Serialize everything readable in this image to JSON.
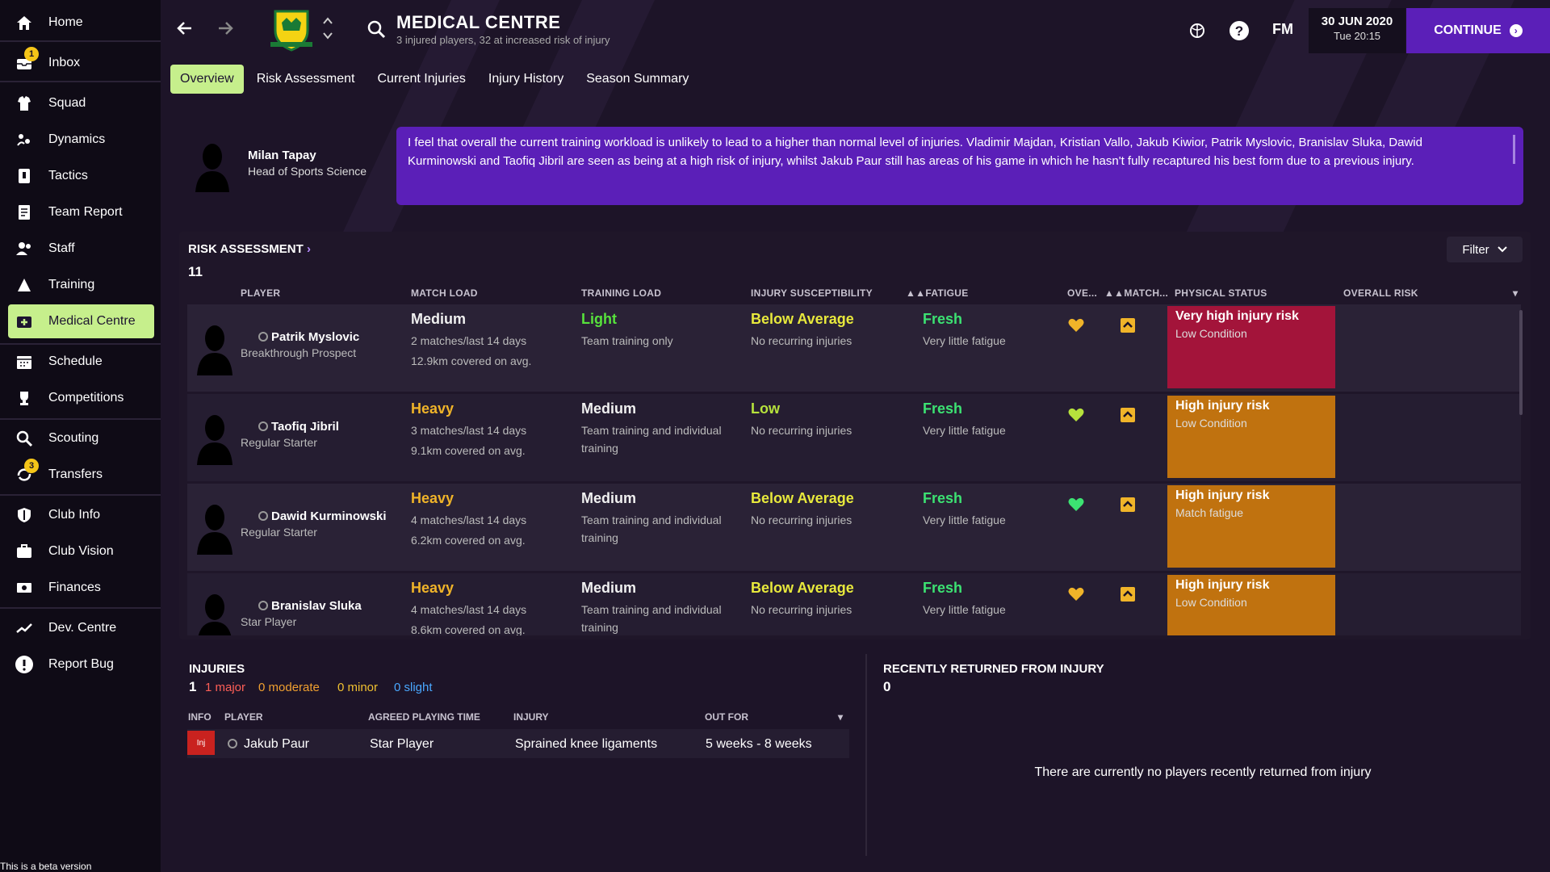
{
  "sidebar": {
    "items": [
      {
        "label": "Home",
        "icon": "home-icon"
      },
      {
        "label": "Inbox",
        "icon": "inbox-icon",
        "badge": "1"
      },
      {
        "label": "Squad",
        "icon": "squad-icon"
      },
      {
        "label": "Dynamics",
        "icon": "dynamics-icon"
      },
      {
        "label": "Tactics",
        "icon": "tactics-icon"
      },
      {
        "label": "Team Report",
        "icon": "report-icon"
      },
      {
        "label": "Staff",
        "icon": "staff-icon"
      },
      {
        "label": "Training",
        "icon": "training-icon"
      },
      {
        "label": "Medical Centre",
        "icon": "medical-icon"
      },
      {
        "label": "Schedule",
        "icon": "calendar-icon"
      },
      {
        "label": "Competitions",
        "icon": "trophy-icon"
      },
      {
        "label": "Scouting",
        "icon": "search-icon"
      },
      {
        "label": "Transfers",
        "icon": "transfers-icon",
        "badge": "3"
      },
      {
        "label": "Club Info",
        "icon": "shield-icon"
      },
      {
        "label": "Club Vision",
        "icon": "briefcase-icon"
      },
      {
        "label": "Finances",
        "icon": "money-icon"
      },
      {
        "label": "Dev. Centre",
        "icon": "chart-icon"
      },
      {
        "label": "Report Bug",
        "icon": "alert-icon"
      }
    ],
    "active": "Medical Centre",
    "beta": "This is a beta version"
  },
  "header": {
    "title": "MEDICAL CENTRE",
    "subtitle": "3 injured players, 32 at increased risk of injury",
    "logo": "FM",
    "date": "30 JUN 2020",
    "time": "Tue 20:15",
    "continue": "CONTINUE"
  },
  "tabs": [
    "Overview",
    "Risk Assessment",
    "Current Injuries",
    "Injury History",
    "Season Summary"
  ],
  "staff": {
    "name": "Milan Tapay",
    "role": "Head of Sports Science",
    "advice": "I feel that overall the current training workload is unlikely to lead to a higher than normal level of injuries. Vladimir Majdan, Kristian Vallo, Jakub Kiwior, Patrik Myslovic, Branislav Sluka, Dawid Kurminowski and Taofiq Jibril are seen as being at a high risk of injury, whilst Jakub Paur still has areas of his game in which he hasn't fully recaptured his best form due to a previous injury."
  },
  "risk": {
    "title": "RISK ASSESSMENT",
    "count": "11",
    "filter": "Filter",
    "columns": {
      "player": "PLAYER",
      "match_load": "MATCH LOAD",
      "training_load": "TRAINING LOAD",
      "injury_susceptibility": "INJURY SUSCEPTIBILITY",
      "fatigue": "FATIGUE",
      "overall": "OVE...",
      "match": "MATCH...",
      "physical_status": "PHYSICAL STATUS",
      "overall_risk": "OVERALL RISK"
    },
    "rows": [
      {
        "name": "Patrik Myslovic",
        "role": "Breakthrough Prospect",
        "match_load": "Medium",
        "match_sub1": "2 matches/last 14 days",
        "match_sub2": "12.9km covered on avg.",
        "training_load": "Light",
        "training_sub": "Team training only",
        "susceptibility": "Below Average",
        "susc_sub": "No recurring injuries",
        "fatigue": "Fresh",
        "fatigue_sub": "Very little fatigue",
        "heart_color": "#f0b429",
        "risk": "Very high injury risk",
        "risk_sub": "Low Condition",
        "risk_color": "#a3143a",
        "match_color": "#f0f0f0",
        "training_color": "#57e23c",
        "susc_color": "#e8e93c"
      },
      {
        "name": "Taofiq Jibril",
        "role": "Regular Starter",
        "match_load": "Heavy",
        "match_sub1": "3 matches/last 14 days",
        "match_sub2": "9.1km covered on avg.",
        "training_load": "Medium",
        "training_sub": "Team training and individual training",
        "susceptibility": "Low",
        "susc_sub": "No recurring injuries",
        "fatigue": "Fresh",
        "fatigue_sub": "Very little fatigue",
        "heart_color": "#b6e23c",
        "risk": "High injury risk",
        "risk_sub": "Low Condition",
        "risk_color": "#c0720f",
        "match_color": "#f0b429",
        "training_color": "#f0f0f0",
        "susc_color": "#b6e23c"
      },
      {
        "name": "Dawid Kurminowski",
        "role": "Regular Starter",
        "match_load": "Heavy",
        "match_sub1": "4 matches/last 14 days",
        "match_sub2": "6.2km covered on avg.",
        "training_load": "Medium",
        "training_sub": "Team training and individual training",
        "susceptibility": "Below Average",
        "susc_sub": "No recurring injuries",
        "fatigue": "Fresh",
        "fatigue_sub": "Very little fatigue",
        "heart_color": "#3ce272",
        "risk": "High injury risk",
        "risk_sub": "Match fatigue",
        "risk_color": "#c0720f",
        "match_color": "#f0b429",
        "training_color": "#f0f0f0",
        "susc_color": "#e8e93c"
      },
      {
        "name": "Branislav Sluka",
        "role": "Star Player",
        "match_load": "Heavy",
        "match_sub1": "4 matches/last 14 days",
        "match_sub2": "8.6km covered on avg.",
        "training_load": "Medium",
        "training_sub": "Team training and individual training",
        "susceptibility": "Below Average",
        "susc_sub": "No recurring injuries",
        "fatigue": "Fresh",
        "fatigue_sub": "Very little fatigue",
        "heart_color": "#f0b429",
        "risk": "High injury risk",
        "risk_sub": "Low Condition",
        "risk_color": "#c0720f",
        "match_color": "#f0b429",
        "training_color": "#f0f0f0",
        "susc_color": "#e8e93c"
      }
    ]
  },
  "injuries": {
    "title": "INJURIES",
    "count": "1",
    "major": "1 major",
    "moderate": "0 moderate",
    "minor": "0 minor",
    "slight": "0 slight",
    "columns": {
      "info": "INFO",
      "player": "PLAYER",
      "agreed": "AGREED PLAYING TIME",
      "injury": "INJURY",
      "out_for": "OUT FOR"
    },
    "row": {
      "tag": "Inj",
      "player": "Jakub Paur",
      "agreed": "Star Player",
      "injury": "Sprained knee ligaments",
      "out_for": "5 weeks - 8 weeks"
    }
  },
  "recent": {
    "title": "RECENTLY RETURNED FROM INJURY",
    "count": "0",
    "empty": "There are currently no players recently returned from injury"
  },
  "colors": {
    "accent": "#c6ef8c",
    "purple": "#5b1fb8",
    "danger": "#c9221f",
    "fresh": "#3ce272"
  }
}
